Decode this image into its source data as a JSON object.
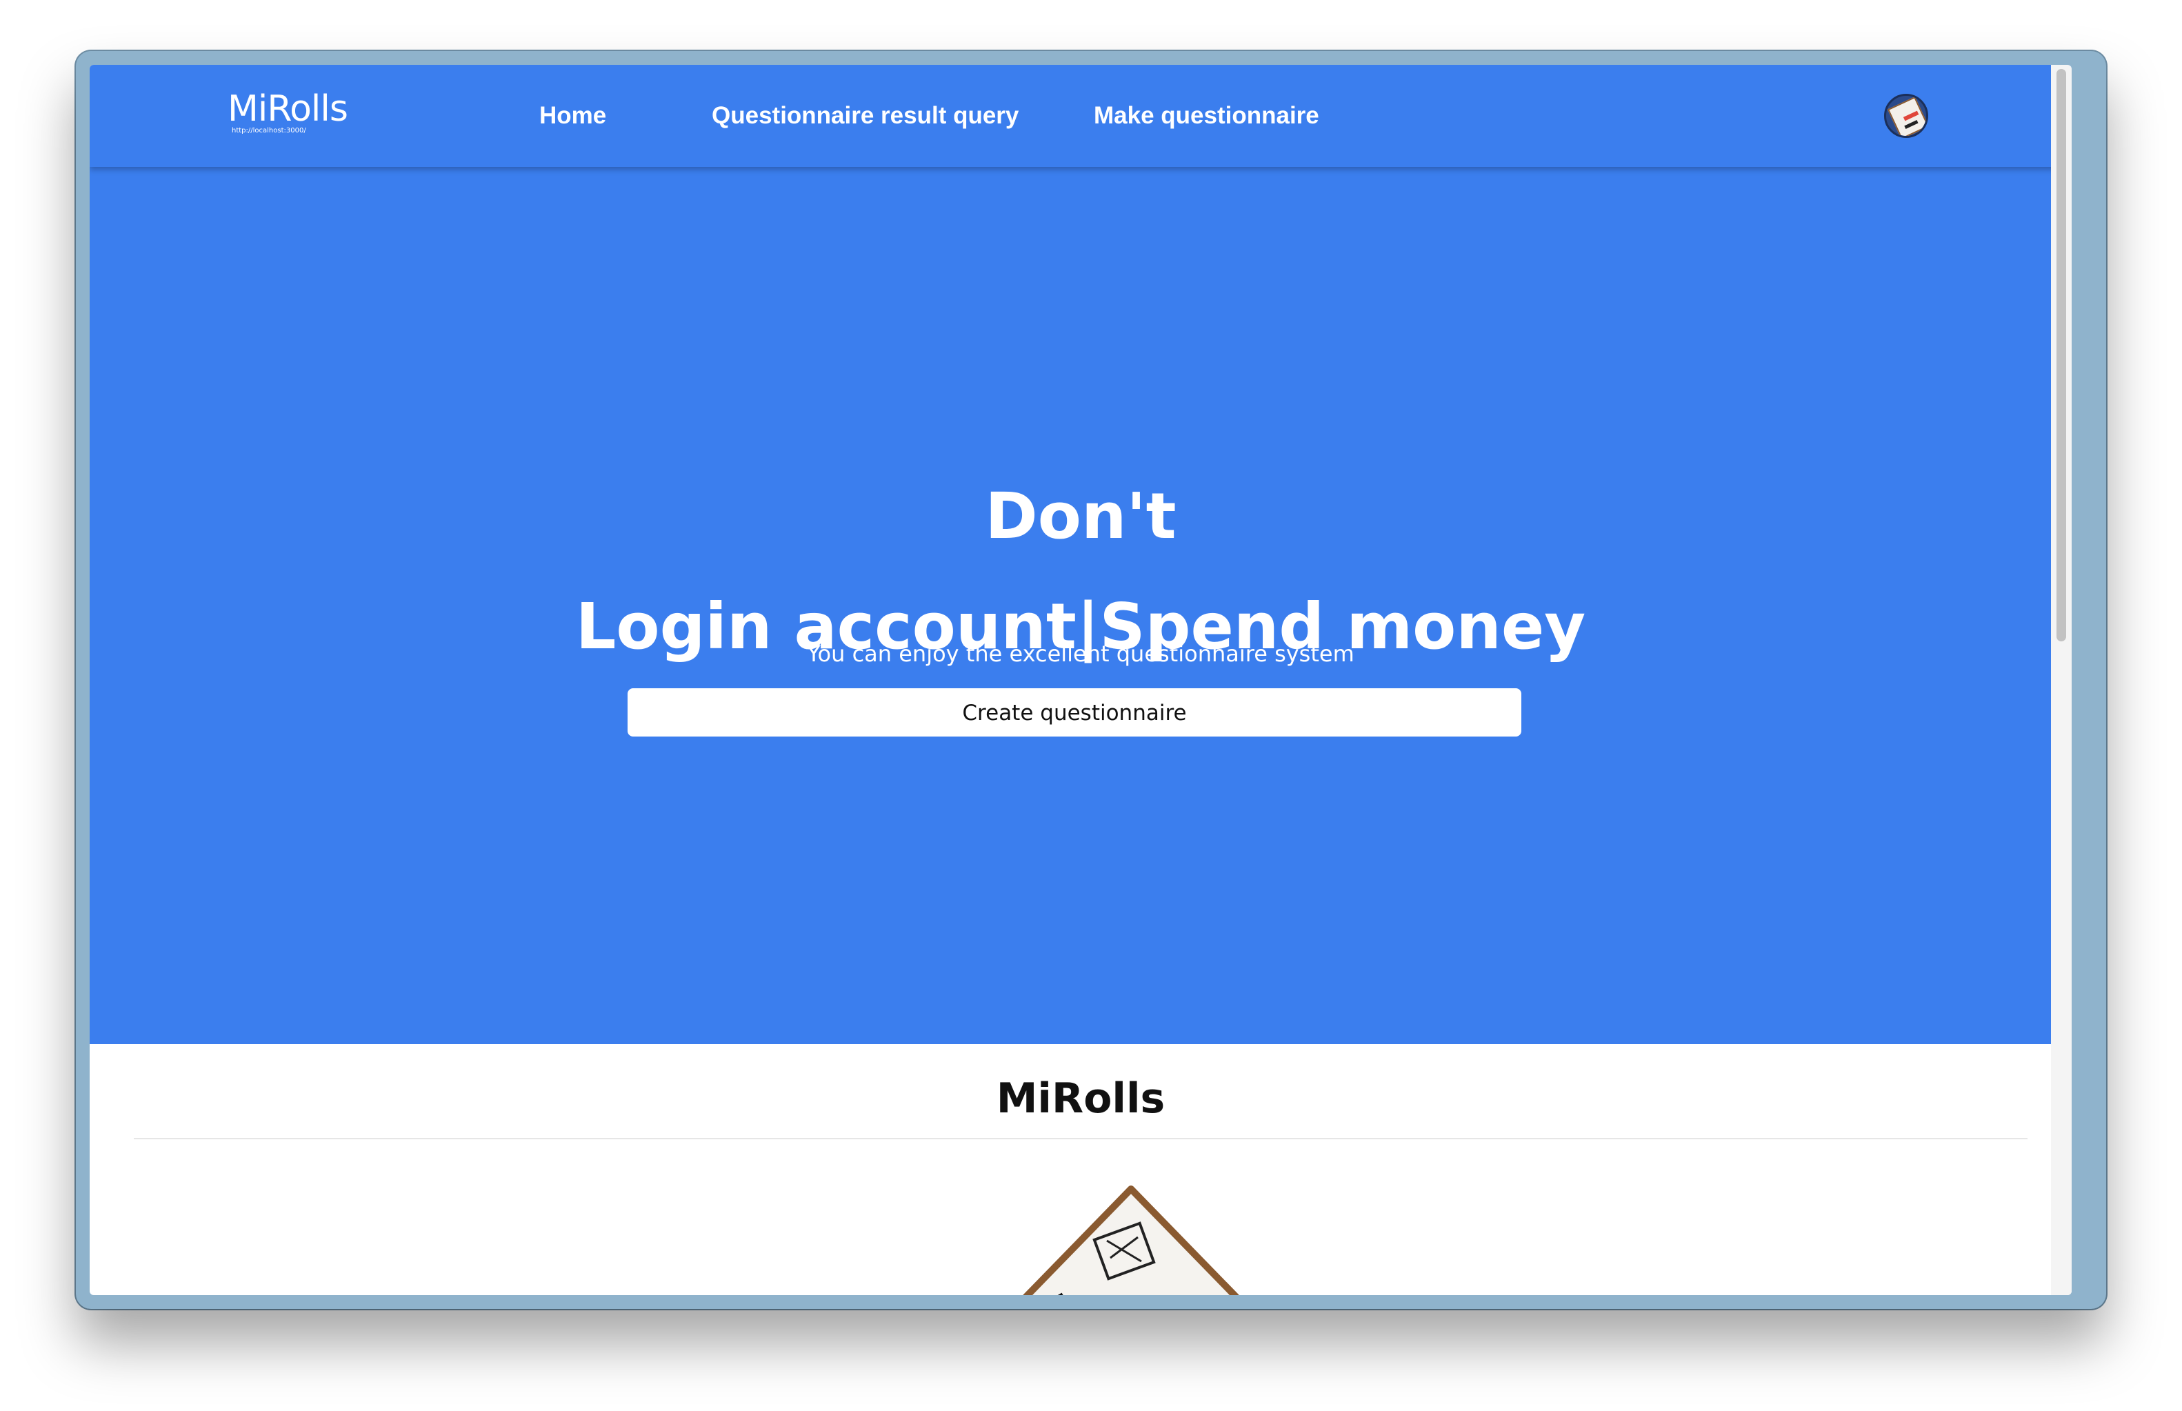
{
  "app": {
    "logo_title": "MiRolls",
    "logo_url": "http://localhost:3000/"
  },
  "nav": {
    "items": [
      {
        "label": "Home"
      },
      {
        "label": "Questionnaire result query"
      },
      {
        "label": "Make questionnaire"
      }
    ]
  },
  "hero": {
    "title_line1": "Don't",
    "title_line2": "Login account|Spend money",
    "subtitle": "You can enjoy the excellent questionnaire system",
    "cta_label": "Create questionnaire"
  },
  "section": {
    "title": "MiRolls"
  },
  "colors": {
    "primary": "#3b7eee",
    "button_bg": "#ffffff",
    "text_dark": "#111111"
  },
  "icons": {
    "avatar": "user-avatar-icon",
    "illustration": "questionnaire-illustration"
  }
}
